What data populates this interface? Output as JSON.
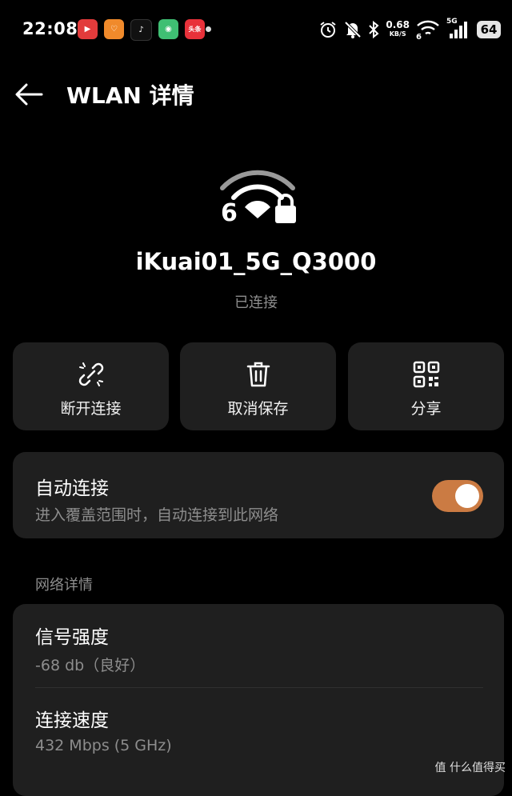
{
  "status_bar": {
    "time": "22:08",
    "app_icons": [
      {
        "name": "video-app-icon",
        "color": "#e23b3b",
        "glyph": "▶"
      },
      {
        "name": "orange-app-icon",
        "color": "#f08a2b",
        "glyph": "♡"
      },
      {
        "name": "tiktok-app-icon",
        "color": "#111111",
        "glyph": "♪"
      },
      {
        "name": "green-app-icon",
        "color": "#3fbf73",
        "glyph": "◉"
      },
      {
        "name": "toutiao-app-icon",
        "color": "#e8313a",
        "glyph": "头条"
      }
    ],
    "net_speed": "0.68",
    "net_speed_unit": "KB/S",
    "wifi_badge": "6",
    "cell_badge": "5G",
    "battery": "64"
  },
  "header": {
    "title": "WLAN 详情"
  },
  "network": {
    "ssid": "iKuai01_5G_Q3000",
    "status": "已连接",
    "wifi_generation": "6"
  },
  "actions": [
    {
      "label": "断开连接",
      "icon": "unlink-icon"
    },
    {
      "label": "取消保存",
      "icon": "trash-icon"
    },
    {
      "label": "分享",
      "icon": "qr-code-icon"
    }
  ],
  "auto_connect": {
    "title": "自动连接",
    "description": "进入覆盖范围时，自动连接到此网络",
    "enabled": true,
    "accent": "#cb7b43"
  },
  "details": {
    "section_label": "网络详情",
    "rows": [
      {
        "title": "信号强度",
        "value": "-68 db（良好）"
      },
      {
        "title": "连接速度",
        "value": "432 Mbps (5 GHz)"
      }
    ]
  },
  "watermark": "值 什么值得买"
}
